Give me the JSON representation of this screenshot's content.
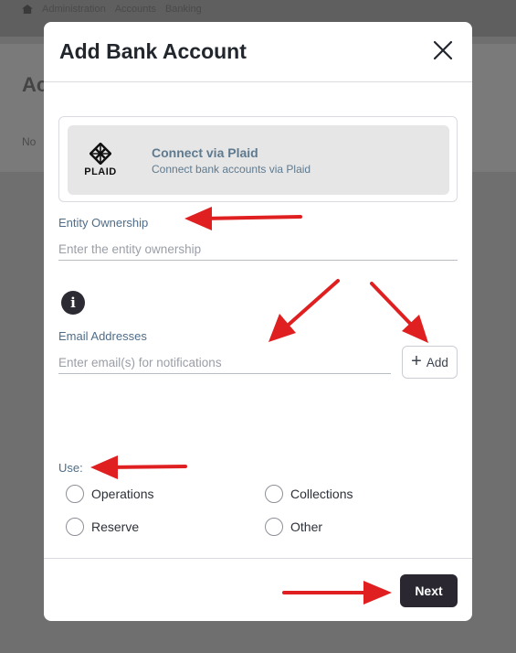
{
  "background": {
    "breadcrumbs": [
      "Administration",
      "Accounts",
      "Banking"
    ],
    "heading": "Accounts",
    "subtext": "No"
  },
  "modal": {
    "title": "Add Bank Account",
    "plaid": {
      "logo_text": "PLAID",
      "title": "Connect via Plaid",
      "subtitle": "Connect bank accounts via Plaid"
    },
    "entity_ownership": {
      "label": "Entity Ownership",
      "placeholder": "Enter the entity ownership",
      "value": ""
    },
    "info_icon_glyph": "i",
    "email": {
      "label": "Email Addresses",
      "placeholder": "Enter email(s) for notifications",
      "value": "",
      "add_label": "Add",
      "add_glyph": "+"
    },
    "use": {
      "label": "Use:",
      "options": [
        "Operations",
        "Collections",
        "Reserve",
        "Other"
      ]
    },
    "next_label": "Next"
  },
  "colors": {
    "primary_button": "#2a2731",
    "label_blue": "#4f6d88",
    "annotation_arrow": "#e02020",
    "overlay": "#6f6f6f"
  },
  "icons": {
    "close": "close-icon",
    "info": "info-icon",
    "plus": "plus-icon",
    "plaid": "plaid-logo-icon"
  }
}
